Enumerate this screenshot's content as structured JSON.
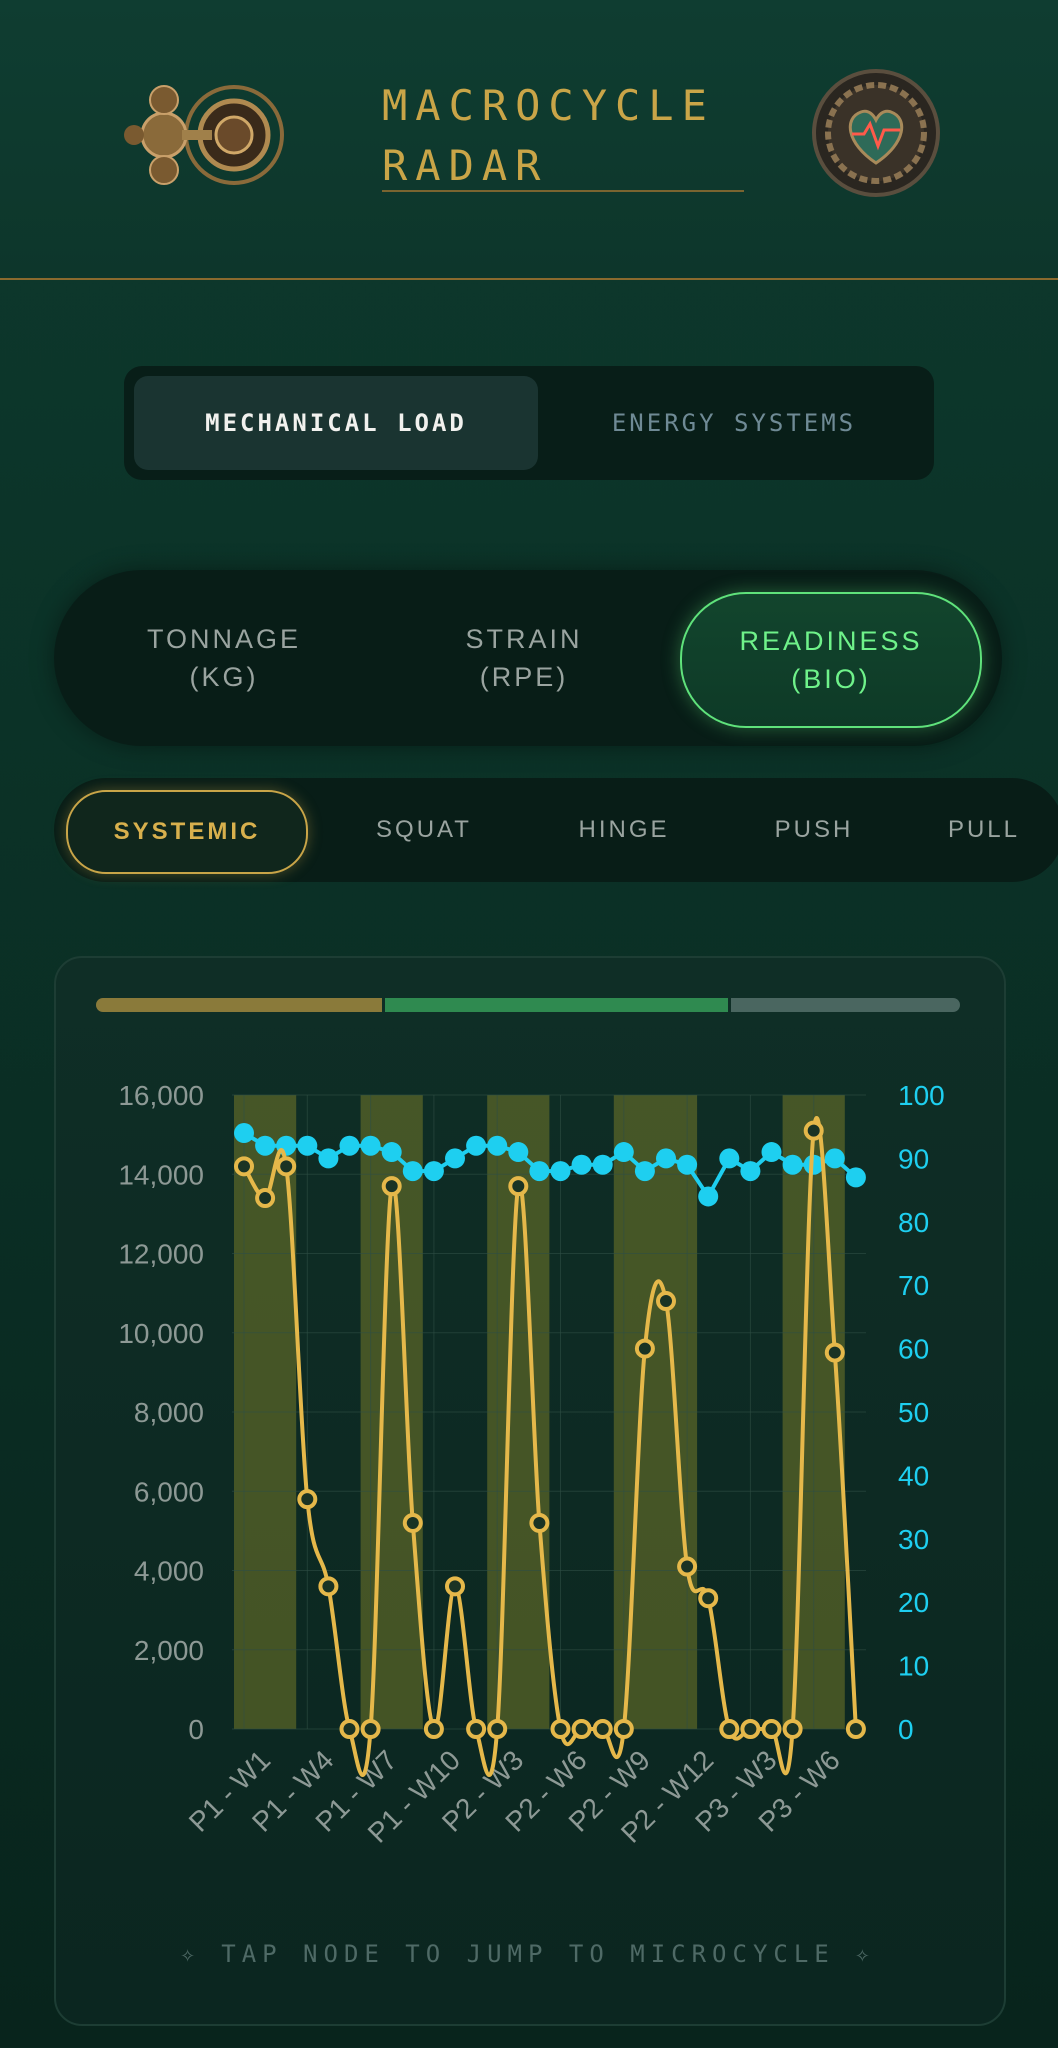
{
  "header": {
    "title": "MACROCYCLE RADAR"
  },
  "tabs": [
    {
      "label": "MECHANICAL LOAD",
      "active": true
    },
    {
      "label": "ENERGY SYSTEMS",
      "active": false
    }
  ],
  "metrics": [
    {
      "label": "TONNAGE\n(KG)",
      "active": false
    },
    {
      "label": "STRAIN\n(RPE)",
      "active": false
    },
    {
      "label": "READINESS\n(BIO)",
      "active": true
    }
  ],
  "movements": [
    {
      "label": "SYSTEMIC",
      "active": true
    },
    {
      "label": "SQUAT",
      "active": false
    },
    {
      "label": "HINGE",
      "active": false
    },
    {
      "label": "PUSH",
      "active": false
    },
    {
      "label": "PULL",
      "active": false
    }
  ],
  "footer": {
    "hint": "✧ TAP NODE TO JUMP TO MICROCYCLE ✧"
  },
  "colors": {
    "tonnage": "#e5b84a",
    "readiness": "#1ecff0",
    "phase1": "#8a7a3a",
    "phase2": "#2f8a50",
    "phase3": "#4a6660"
  },
  "chart_data": {
    "type": "line",
    "x_tick_labels": [
      "P1 - W1",
      "P1 - W4",
      "P1 - W7",
      "P1 - W10",
      "P2 - W3",
      "P2 - W6",
      "P2 - W9",
      "P2 - W12",
      "P3 - W3",
      "P3 - W6"
    ],
    "y_left_ticks": [
      "16,000",
      "14,000",
      "12,000",
      "10,000",
      "8,000",
      "6,000",
      "4,000",
      "2,000",
      "0"
    ],
    "y_right_ticks": [
      "100",
      "90",
      "80",
      "70",
      "60",
      "50",
      "40",
      "30",
      "20",
      "10",
      "0"
    ],
    "y_left_range": [
      0,
      16000
    ],
    "y_right_range": [
      0,
      100
    ],
    "series": [
      {
        "axis": "left",
        "values": [
          14200,
          13400,
          14200,
          5800,
          3600,
          0,
          0,
          13700,
          5200,
          0,
          3600,
          0,
          0,
          13700,
          5200,
          0,
          0,
          0,
          0,
          9600,
          10800,
          4100,
          3300,
          0,
          0,
          0,
          0,
          15100,
          9500,
          0
        ]
      },
      {
        "axis": "right",
        "values": [
          94,
          92,
          92,
          92,
          90,
          92,
          92,
          91,
          88,
          88,
          90,
          92,
          92,
          91,
          88,
          88,
          89,
          89,
          91,
          88,
          90,
          89,
          84,
          90,
          88,
          91,
          89,
          89,
          90,
          87
        ]
      }
    ],
    "phases": [
      {
        "from": 0,
        "to": 13
      },
      {
        "from": 13,
        "to": 24
      },
      {
        "from": 24,
        "to": 30
      }
    ],
    "highlight_bands": [
      {
        "from": 0,
        "to": 2
      },
      {
        "from": 6,
        "to": 8
      },
      {
        "from": 12,
        "to": 14
      },
      {
        "from": 18,
        "to": 21
      },
      {
        "from": 26,
        "to": 28
      }
    ],
    "grid": true
  }
}
